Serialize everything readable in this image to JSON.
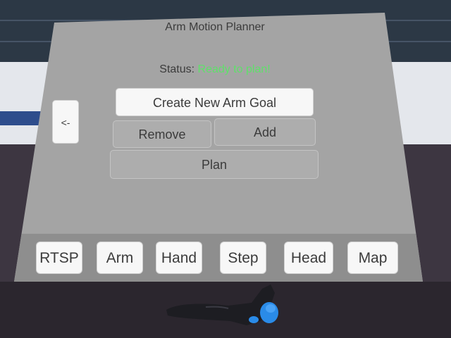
{
  "panel": {
    "title": "Arm Motion Planner",
    "status_label": "Status:",
    "status_value": "Ready to plan!"
  },
  "buttons": {
    "back": "<-",
    "create_goal": "Create New Arm Goal",
    "remove": "Remove",
    "add": "Add",
    "plan": "Plan"
  },
  "toolbar": {
    "items": [
      "RTSP",
      "Arm",
      "Hand",
      "Step",
      "Head",
      "Map"
    ]
  },
  "colors": {
    "panel": "#a4a4a4",
    "toolbar": "#8e8e8e",
    "status_ok": "#5fe06a",
    "button_light": "#f7f7f7",
    "button_dark": "#adadad",
    "wall_stripe": "#2e4d8c",
    "controller_accent": "#2a8be8"
  }
}
